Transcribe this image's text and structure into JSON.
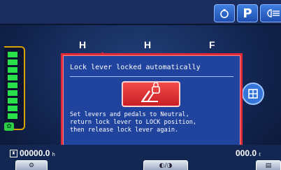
{
  "topbar": {
    "engine_icon": "engine-mode-icon",
    "parking_label": "P",
    "light_icon": "light-icon"
  },
  "gauges": {
    "coolant_label": "H",
    "oil_label": "H",
    "fuel_label": "F"
  },
  "dialog": {
    "title": "Lock lever locked automatically",
    "icon": "lock-lever-warning-icon",
    "message": "Set levers and pedals to Neutral,\nreturn lock lever to LOCK position,\nthen release lock lever again."
  },
  "side_icon": "transmission-icon",
  "bottombar": {
    "hours_value": "00000.0",
    "hours_unit": "h",
    "right_value": "000.0",
    "right_unit": "ℓ",
    "buttons": [
      "menu-1-icon",
      "screen-toggle-icon",
      "menu-3-icon"
    ]
  },
  "colors": {
    "background": "#132753",
    "dialog": "#20439e",
    "alert": "#e02a39",
    "gauge_green": "#27e04a",
    "gauge_yellow": "#e6c11f",
    "accent": "#3f7fe0"
  }
}
